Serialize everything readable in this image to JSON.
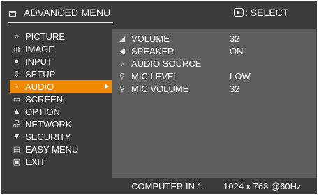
{
  "header": {
    "title": "ADVANCED MENU",
    "select_hint": ": SELECT",
    "menu_icon": "menu-icon",
    "enter_icon": "enter-icon"
  },
  "sidebar": {
    "items": [
      {
        "label": "PICTURE",
        "icon": "picture-icon",
        "glyph": "☼",
        "active": false
      },
      {
        "label": "IMAGE",
        "icon": "image-icon",
        "glyph": "◍",
        "active": false
      },
      {
        "label": "INPUT",
        "icon": "input-icon",
        "glyph": "●",
        "active": false
      },
      {
        "label": "SETUP",
        "icon": "setup-icon",
        "glyph": "⇩",
        "active": false
      },
      {
        "label": "AUDIO",
        "icon": "audio-icon",
        "glyph": "♪",
        "active": true
      },
      {
        "label": "SCREEN",
        "icon": "screen-icon",
        "glyph": "▭",
        "active": false
      },
      {
        "label": "OPTION",
        "icon": "option-icon",
        "glyph": "▲",
        "active": false
      },
      {
        "label": "NETWORK",
        "icon": "network-icon",
        "glyph": "品",
        "active": false
      },
      {
        "label": "SECURITY",
        "icon": "security-icon",
        "glyph": "▼",
        "active": false
      },
      {
        "label": "EASY MENU",
        "icon": "easy-menu-icon",
        "glyph": "▤",
        "active": false
      },
      {
        "label": "EXIT",
        "icon": "exit-icon",
        "glyph": "▣",
        "active": false
      }
    ]
  },
  "audio_panel": {
    "rows": [
      {
        "label": "VOLUME",
        "value": "32",
        "icon": "volume-icon",
        "glyph": "◢"
      },
      {
        "label": "SPEAKER",
        "value": "ON",
        "icon": "speaker-icon",
        "glyph": "◀"
      },
      {
        "label": "AUDIO SOURCE",
        "value": "",
        "icon": "audio-source-icon",
        "glyph": "♪"
      },
      {
        "label": "MIC LEVEL",
        "value": "LOW",
        "icon": "mic-level-icon",
        "glyph": "⚲"
      },
      {
        "label": "MIC VOLUME",
        "value": "32",
        "icon": "mic-volume-icon",
        "glyph": "⚲"
      }
    ]
  },
  "footer": {
    "input": "COMPUTER IN 1",
    "resolution": "1024 x 768 @60Hz"
  },
  "colors": {
    "accent": "#f08a00",
    "background": "#3b3b3b",
    "panel": "#5e5e5e"
  }
}
